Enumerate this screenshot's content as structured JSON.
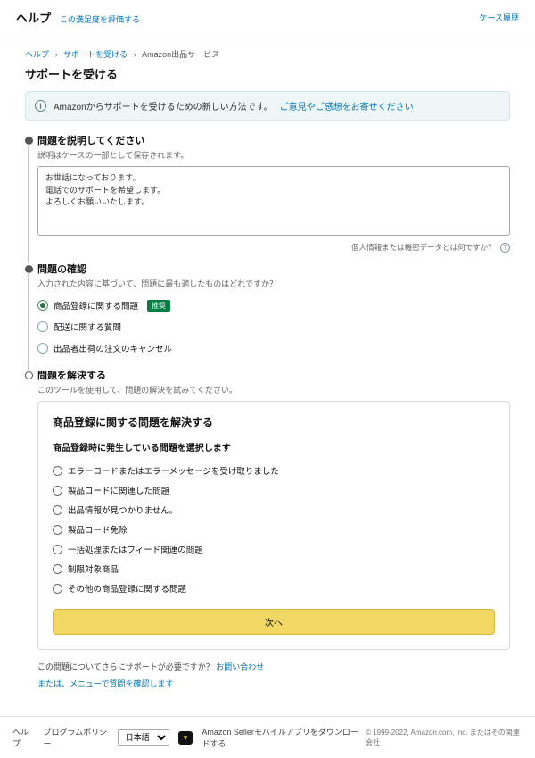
{
  "header": {
    "help": "ヘルプ",
    "rate_link": "この満足度を評価する",
    "case_history": "ケース履歴"
  },
  "breadcrumb": {
    "a": "ヘルプ",
    "b": "サポートを受ける",
    "c": "Amazon出品サービス"
  },
  "page_title": "サポートを受ける",
  "banner": {
    "text": "Amazonからサポートを受けるための新しい方法です。",
    "link": "ご意見やご感想をお寄せください"
  },
  "step1": {
    "title": "問題を説明してください",
    "sub": "説明はケースの一部として保存されます。",
    "value": "お世話になっております。\n電話でのサポートを希望します。\nよろしくお願いいたします。",
    "footer": "個人情報または機密データとは何ですか？"
  },
  "step2": {
    "title": "問題の確認",
    "sub": "入力された内容に基づいて、問題に最も適したものはどれですか？",
    "opt1": "商品登録に関する問題",
    "opt1_tag": "推奨",
    "opt2": "配送に関する質問",
    "opt3": "出品者出荷の注文のキャンセル"
  },
  "step3": {
    "title": "問題を解決する",
    "sub": "このツールを使用して、問題の解決を試みてください。",
    "panel_title": "商品登録に関する問題を解決する",
    "panel_sub": "商品登録時に発生している問題を選択します",
    "opts": [
      "エラーコードまたはエラーメッセージを受け取りました",
      "製品コードに関連した問題",
      "出品情報が見つかりません。",
      "製品コード免除",
      "一括処理またはフィード関連の問題",
      "制限対象商品",
      "その他の商品登録に関する問題"
    ],
    "next": "次へ",
    "support_q": "この問題についてさらにサポートが必要ですか？",
    "contact": "お問い合わせ",
    "or_link": "または、メニューで質問を確認します"
  },
  "footer": {
    "help": "ヘルプ",
    "policy": "プログラムポリシー",
    "lang": "日本語",
    "app": "Amazon Sellerモバイルアプリをダウンロードする",
    "copyright": "© 1999-2022, Amazon.com, Inc. またはその関連会社"
  }
}
